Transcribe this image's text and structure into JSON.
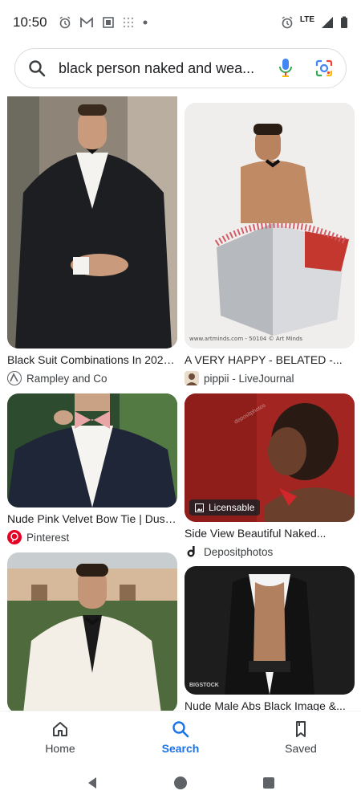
{
  "status_bar": {
    "time": "10:50",
    "network": "LTE"
  },
  "search": {
    "query": "black person naked and wea...",
    "icons": [
      "search-icon",
      "microphone-icon",
      "lens-icon"
    ]
  },
  "results": {
    "left": [
      {
        "title": "Black Suit Combinations In 2024...",
        "source": "Rampley and Co",
        "source_icon": "rampley-logo-icon"
      },
      {
        "title": "Nude Pink Velvet Bow Tie | Dust...",
        "source": "Pinterest",
        "source_icon": "pinterest-icon"
      },
      {
        "title": "",
        "source": "",
        "source_icon": ""
      }
    ],
    "right": [
      {
        "title": "A VERY HAPPY - BELATED -...",
        "source": "pippii - LiveJournal",
        "source_icon": "avatar-icon",
        "caption": "www.artminds.com - 50104 © Art Minds"
      },
      {
        "title": "Side View Beautiful Naked...",
        "source": "Depositphotos",
        "source_icon": "depositphotos-icon",
        "badge": "Licensable",
        "watermark": "depositphotos"
      },
      {
        "title": "Nude Male Abs Black Image &...",
        "source": "",
        "source_icon": "",
        "watermark": "BIGSTOCK"
      }
    ]
  },
  "bottom_nav": {
    "items": [
      {
        "label": "Home",
        "icon": "home-icon"
      },
      {
        "label": "Search",
        "icon": "search-icon",
        "active": true
      },
      {
        "label": "Saved",
        "icon": "bookmark-icon"
      }
    ]
  },
  "colors": {
    "accent": "#1a73e8",
    "text": "#202124",
    "border": "#dadce0"
  }
}
